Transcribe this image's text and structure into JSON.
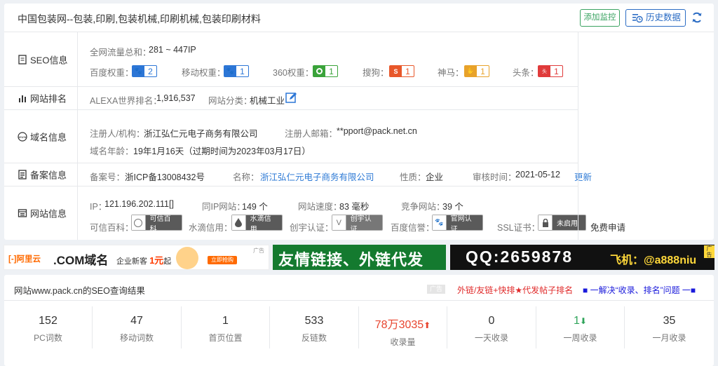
{
  "header": {
    "site_title": "中国包装网--包装,印刷,包装机械,印刷机械,包装印刷材料",
    "monitor_label": "添加监控",
    "history_label": "历史数据"
  },
  "seo": {
    "label": "SEO信息",
    "traffic_key": "全网流量总和：",
    "traffic_val": "281 ~ 447IP",
    "ranks": [
      {
        "key": "百度权重：",
        "value": "2",
        "color": "#2c76d6",
        "icon": "paw-icon"
      },
      {
        "key": "移动权重：",
        "value": "1",
        "color": "#2c76d6",
        "icon": "paw-icon"
      },
      {
        "key": "360权重：",
        "value": "1",
        "color": "#3aa33a",
        "icon": "360-icon"
      },
      {
        "key": "搜狗：",
        "value": "1",
        "color": "#e8572a",
        "icon": "sogou-icon"
      },
      {
        "key": "神马：",
        "value": "1",
        "color": "#e8a22a",
        "icon": "shenma-icon"
      },
      {
        "key": "头条：",
        "value": "1",
        "color": "#e03b3b",
        "icon": "toutiao-icon"
      }
    ]
  },
  "ranking": {
    "label": "网站排名",
    "alexa_key": "ALEXA世界排名：",
    "alexa_val": "1,916,537",
    "category_key": "网站分类：",
    "category_val": "机械工业"
  },
  "domain": {
    "label": "域名信息",
    "registrant_key": "注册人/机构：",
    "registrant_val": "浙江弘仁元电子商务有限公司",
    "email_key": "注册人邮箱：",
    "email_val": "**pport@pack.net.cn",
    "age_key": "域名年龄：",
    "age_val": "19年1月16天（过期时间为2023年03月17日）"
  },
  "beian": {
    "label": "备案信息",
    "no_key": "备案号：",
    "no_val": "浙ICP备13008432号",
    "name_key": "名称：",
    "name_val": "浙江弘仁元电子商务有限公司",
    "type_key": "性质：",
    "type_val": "企业",
    "audit_key": "审核时间：",
    "audit_val": "2021-05-12",
    "update_label": "更新"
  },
  "siteinfo": {
    "label": "网站信息",
    "ip_key": "IP：",
    "ip_val": "121.196.202.111[]",
    "sameip_key": "同IP网站：",
    "sameip_val": "149 个",
    "speed_key": "网站速度：",
    "speed_val": "83 毫秒",
    "compete_key": "竞争网站：",
    "compete_val": "39 个",
    "certs": [
      {
        "key": "可信百科：",
        "badge": "可信百科"
      },
      {
        "key": "水滴信用：",
        "badge": "水滴信用"
      },
      {
        "key": "创宇认证：",
        "badge": "创宇认证"
      },
      {
        "key": "百度信誉：",
        "badge": "官网认证"
      },
      {
        "key": "SSL证书：",
        "badge": "未启用"
      }
    ],
    "ssl_apply": "免费申请"
  },
  "ads": {
    "ad1_brand": "阿里云",
    "ad1_text": ".COM域名",
    "ad1_sub": "企业新客",
    "ad1_price": "1元",
    "ad1_unit": "起",
    "ad1_btn": "立即抢购",
    "ad_tag": "广告",
    "ad2_text": "友情链接、外链代发",
    "ad3_qq": "QQ:2659878",
    "ad3_fly": "飞机：@a888niu",
    "ad3_tag": "广告"
  },
  "results": {
    "title": "网站www.pack.cn的SEO查询结果",
    "ad_tag": "广告",
    "red_promo": "外链/友链+快排★代发帖子排名",
    "blue_promo": "■ 一解决“收录、排名”问题 一■",
    "stats": [
      {
        "value": "152",
        "label": "PC词数",
        "color": "#333333",
        "arrow": ""
      },
      {
        "value": "47",
        "label": "移动词数",
        "color": "#333333",
        "arrow": ""
      },
      {
        "value": "1",
        "label": "首页位置",
        "color": "#333333",
        "arrow": ""
      },
      {
        "value": "533",
        "label": "反链数",
        "color": "#333333",
        "arrow": ""
      },
      {
        "value": "78万3035",
        "label": "收录量",
        "color": "#e8452f",
        "arrow": "up"
      },
      {
        "value": "0",
        "label": "一天收录",
        "color": "#333333",
        "arrow": ""
      },
      {
        "value": "1",
        "label": "一周收录",
        "color": "#2fa45a",
        "arrow": "down"
      },
      {
        "value": "35",
        "label": "一月收录",
        "color": "#333333",
        "arrow": ""
      }
    ]
  }
}
